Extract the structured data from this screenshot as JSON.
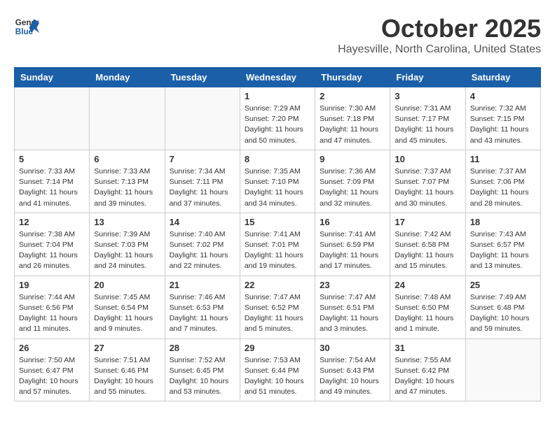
{
  "header": {
    "logo_line1": "General",
    "logo_line2": "Blue",
    "title": "October 2025",
    "subtitle": "Hayesville, North Carolina, United States"
  },
  "weekdays": [
    "Sunday",
    "Monday",
    "Tuesday",
    "Wednesday",
    "Thursday",
    "Friday",
    "Saturday"
  ],
  "weeks": [
    [
      {
        "day": "",
        "info": ""
      },
      {
        "day": "",
        "info": ""
      },
      {
        "day": "",
        "info": ""
      },
      {
        "day": "1",
        "info": "Sunrise: 7:29 AM\nSunset: 7:20 PM\nDaylight: 11 hours\nand 50 minutes."
      },
      {
        "day": "2",
        "info": "Sunrise: 7:30 AM\nSunset: 7:18 PM\nDaylight: 11 hours\nand 47 minutes."
      },
      {
        "day": "3",
        "info": "Sunrise: 7:31 AM\nSunset: 7:17 PM\nDaylight: 11 hours\nand 45 minutes."
      },
      {
        "day": "4",
        "info": "Sunrise: 7:32 AM\nSunset: 7:15 PM\nDaylight: 11 hours\nand 43 minutes."
      }
    ],
    [
      {
        "day": "5",
        "info": "Sunrise: 7:33 AM\nSunset: 7:14 PM\nDaylight: 11 hours\nand 41 minutes."
      },
      {
        "day": "6",
        "info": "Sunrise: 7:33 AM\nSunset: 7:13 PM\nDaylight: 11 hours\nand 39 minutes."
      },
      {
        "day": "7",
        "info": "Sunrise: 7:34 AM\nSunset: 7:11 PM\nDaylight: 11 hours\nand 37 minutes."
      },
      {
        "day": "8",
        "info": "Sunrise: 7:35 AM\nSunset: 7:10 PM\nDaylight: 11 hours\nand 34 minutes."
      },
      {
        "day": "9",
        "info": "Sunrise: 7:36 AM\nSunset: 7:09 PM\nDaylight: 11 hours\nand 32 minutes."
      },
      {
        "day": "10",
        "info": "Sunrise: 7:37 AM\nSunset: 7:07 PM\nDaylight: 11 hours\nand 30 minutes."
      },
      {
        "day": "11",
        "info": "Sunrise: 7:37 AM\nSunset: 7:06 PM\nDaylight: 11 hours\nand 28 minutes."
      }
    ],
    [
      {
        "day": "12",
        "info": "Sunrise: 7:38 AM\nSunset: 7:04 PM\nDaylight: 11 hours\nand 26 minutes."
      },
      {
        "day": "13",
        "info": "Sunrise: 7:39 AM\nSunset: 7:03 PM\nDaylight: 11 hours\nand 24 minutes."
      },
      {
        "day": "14",
        "info": "Sunrise: 7:40 AM\nSunset: 7:02 PM\nDaylight: 11 hours\nand 22 minutes."
      },
      {
        "day": "15",
        "info": "Sunrise: 7:41 AM\nSunset: 7:01 PM\nDaylight: 11 hours\nand 19 minutes."
      },
      {
        "day": "16",
        "info": "Sunrise: 7:41 AM\nSunset: 6:59 PM\nDaylight: 11 hours\nand 17 minutes."
      },
      {
        "day": "17",
        "info": "Sunrise: 7:42 AM\nSunset: 6:58 PM\nDaylight: 11 hours\nand 15 minutes."
      },
      {
        "day": "18",
        "info": "Sunrise: 7:43 AM\nSunset: 6:57 PM\nDaylight: 11 hours\nand 13 minutes."
      }
    ],
    [
      {
        "day": "19",
        "info": "Sunrise: 7:44 AM\nSunset: 6:56 PM\nDaylight: 11 hours\nand 11 minutes."
      },
      {
        "day": "20",
        "info": "Sunrise: 7:45 AM\nSunset: 6:54 PM\nDaylight: 11 hours\nand 9 minutes."
      },
      {
        "day": "21",
        "info": "Sunrise: 7:46 AM\nSunset: 6:53 PM\nDaylight: 11 hours\nand 7 minutes."
      },
      {
        "day": "22",
        "info": "Sunrise: 7:47 AM\nSunset: 6:52 PM\nDaylight: 11 hours\nand 5 minutes."
      },
      {
        "day": "23",
        "info": "Sunrise: 7:47 AM\nSunset: 6:51 PM\nDaylight: 11 hours\nand 3 minutes."
      },
      {
        "day": "24",
        "info": "Sunrise: 7:48 AM\nSunset: 6:50 PM\nDaylight: 11 hours\nand 1 minute."
      },
      {
        "day": "25",
        "info": "Sunrise: 7:49 AM\nSunset: 6:48 PM\nDaylight: 10 hours\nand 59 minutes."
      }
    ],
    [
      {
        "day": "26",
        "info": "Sunrise: 7:50 AM\nSunset: 6:47 PM\nDaylight: 10 hours\nand 57 minutes."
      },
      {
        "day": "27",
        "info": "Sunrise: 7:51 AM\nSunset: 6:46 PM\nDaylight: 10 hours\nand 55 minutes."
      },
      {
        "day": "28",
        "info": "Sunrise: 7:52 AM\nSunset: 6:45 PM\nDaylight: 10 hours\nand 53 minutes."
      },
      {
        "day": "29",
        "info": "Sunrise: 7:53 AM\nSunset: 6:44 PM\nDaylight: 10 hours\nand 51 minutes."
      },
      {
        "day": "30",
        "info": "Sunrise: 7:54 AM\nSunset: 6:43 PM\nDaylight: 10 hours\nand 49 minutes."
      },
      {
        "day": "31",
        "info": "Sunrise: 7:55 AM\nSunset: 6:42 PM\nDaylight: 10 hours\nand 47 minutes."
      },
      {
        "day": "",
        "info": ""
      }
    ]
  ]
}
